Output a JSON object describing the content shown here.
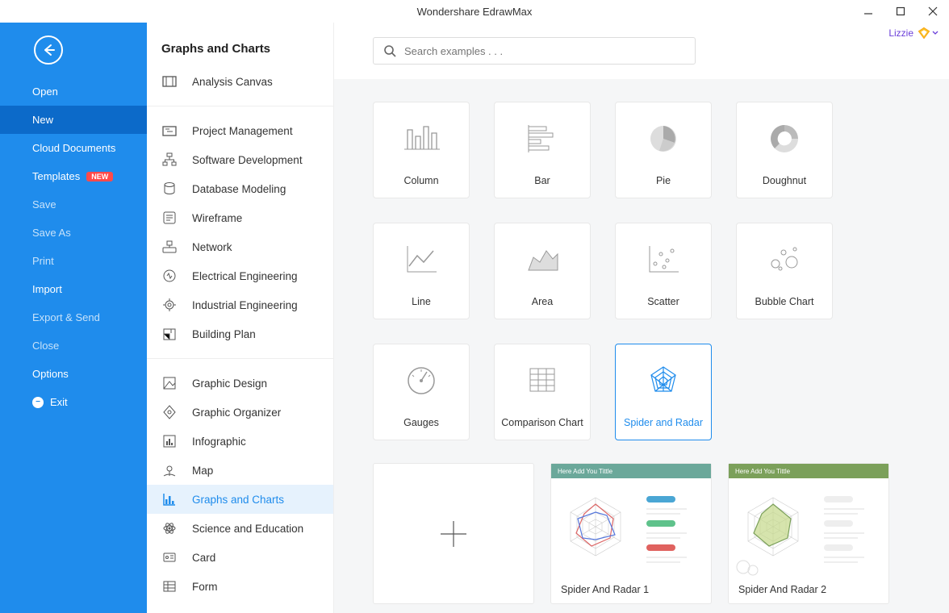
{
  "title": "Wondershare EdrawMax",
  "user": {
    "name": "Lizzie"
  },
  "sidebar": {
    "items": [
      {
        "label": "Open",
        "style": "bold"
      },
      {
        "label": "New",
        "style": "bold",
        "sel": true
      },
      {
        "label": "Cloud Documents",
        "style": "bold"
      },
      {
        "label": "Templates",
        "style": "bold",
        "badge": "NEW"
      },
      {
        "label": "Save",
        "style": "dim"
      },
      {
        "label": "Save As",
        "style": "dim"
      },
      {
        "label": "Print",
        "style": "dim"
      },
      {
        "label": "Import",
        "style": "bold"
      },
      {
        "label": "Export & Send",
        "style": "dim"
      },
      {
        "label": "Close",
        "style": "dim"
      },
      {
        "label": "Options",
        "style": "bold"
      },
      {
        "label": "Exit",
        "style": "bold",
        "exit": true
      }
    ]
  },
  "category_header": "Graphs and Charts",
  "categories": [
    [
      "Analysis Canvas"
    ],
    [
      "Project Management",
      "Software Development",
      "Database Modeling",
      "Wireframe",
      "Network",
      "Electrical Engineering",
      "Industrial Engineering",
      "Building Plan"
    ],
    [
      "Graphic Design",
      "Graphic Organizer",
      "Infographic",
      "Map",
      "Graphs and Charts",
      "Science and Education",
      "Card",
      "Form"
    ]
  ],
  "selected_category": "Graphs and Charts",
  "search": {
    "placeholder": "Search examples . . ."
  },
  "tiles": [
    {
      "label": "Column"
    },
    {
      "label": "Bar"
    },
    {
      "label": "Pie"
    },
    {
      "label": "Doughnut"
    },
    {
      "label": "Line"
    },
    {
      "label": "Area"
    },
    {
      "label": "Scatter"
    },
    {
      "label": "Bubble Chart"
    },
    {
      "label": "Gauges"
    },
    {
      "label": "Comparison Chart"
    },
    {
      "label": "Spider and Radar",
      "sel": true
    }
  ],
  "templates": [
    {
      "label": ""
    },
    {
      "label": "Spider And Radar 1",
      "band": "teal",
      "band_text": "Here Add You Tittle"
    },
    {
      "label": "Spider And Radar 2",
      "band": "green",
      "band_text": "Here Add You Tittle"
    }
  ]
}
